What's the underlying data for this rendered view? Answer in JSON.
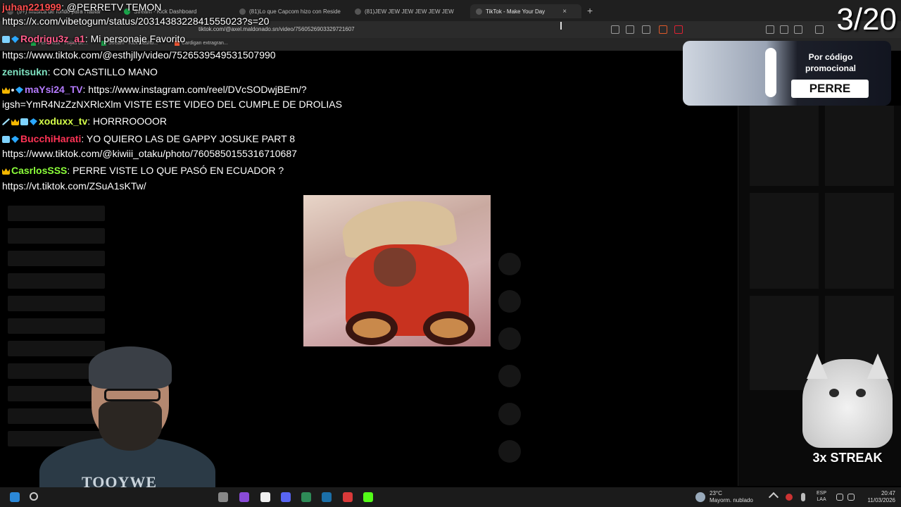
{
  "browser": {
    "tabs": [
      {
        "label": "(9+) Música de fondo para Hablar",
        "active": false
      },
      {
        "label": "Stream - Kick Dashboard",
        "active": false
      },
      {
        "label": "(81)Lo que Capcom hizo con Reside",
        "active": false
      },
      {
        "label": "(81)JEW JEW JEW JEW JEW JEW",
        "active": false
      },
      {
        "label": "TikTok - Make Your Day",
        "active": true
      }
    ],
    "close_glyph": "×",
    "new_tab_glyph": "+",
    "url": "tiktok.com/@axel.maldonado.sn/video/7560526903329721607",
    "bookmarks": [
      "Perre.xlsx - Hojas de...",
      "Stream - Kick Dashb...",
      "Cardigan extragran..."
    ]
  },
  "counter": "3/20",
  "chat": [
    {
      "user": "juhan221999",
      "text": ": @PERRETV TEMON",
      "color": "#ff4d4d",
      "badges": []
    },
    {
      "user": "",
      "text": "https://x.com/vibetogum/status/2031438322841555023?s=20",
      "color": "#fff",
      "badges": []
    },
    {
      "user": "Rodrigu3z_a1",
      "text": ": Mi personaje Favorito",
      "color": "#ff5c8a",
      "badges": [
        "grid",
        "gem"
      ]
    },
    {
      "user": "",
      "text": "https://www.tiktok.com/@esthjlly/video/7526539549531507990",
      "color": "#fff",
      "badges": []
    },
    {
      "user": "zenitsukn",
      "text": ": CON CASTILLO MANO",
      "color": "#7fe3c2",
      "badges": []
    },
    {
      "user": "maYsi24_TV",
      "text": ": https://www.instagram.com/reel/DVcSODwjBEm/?",
      "color": "#b57bff",
      "badges": [
        "crown",
        "dot",
        "gem"
      ]
    },
    {
      "user": "",
      "text": "igsh=YmR4NzZzNXRlcXlm VISTE ESTE VIDEO DEL CUMPLE DE DROLIAS",
      "color": "#fff",
      "badges": []
    },
    {
      "user": "xoduxx_tv",
      "text": ": HORRROOOOR",
      "color": "#d6ff4a",
      "badges": [
        "sword",
        "crown",
        "grid",
        "gem"
      ]
    },
    {
      "user": "BucchiHarati",
      "text": ": YO QUIERO LAS DE GAPPY JOSUKE PART 8",
      "color": "#ff3355",
      "badges": [
        "grid",
        "gem"
      ]
    },
    {
      "user": "",
      "text": "https://www.tiktok.com/@kiwiii_otaku/photo/7605850155316710687",
      "color": "#fff",
      "badges": []
    },
    {
      "user": "CasrlosSSS",
      "text": ": PERRE VISTE LO QUE PASÓ EN ECUADOR ?",
      "color": "#8cff3a",
      "badges": [
        "crown"
      ]
    },
    {
      "user": "",
      "text": "https://vt.tiktok.com/ZSuA1sKTw/",
      "color": "#fff",
      "badges": []
    }
  ],
  "promo": {
    "line1": "Por código",
    "line2": "promocional",
    "code": "PERRE"
  },
  "streak": "3x STREAK",
  "webcam": {
    "shirt_text": "TOOYWE"
  },
  "taskbar": {
    "weather_temp": "23°C",
    "weather_desc": "Mayorm. nublado",
    "lang1": "ESP",
    "lang2": "LAA",
    "time": "20:47",
    "date": "11/03/2026"
  }
}
